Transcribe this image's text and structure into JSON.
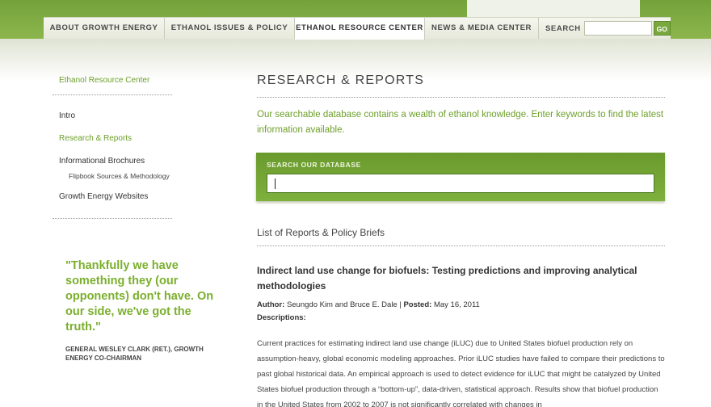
{
  "nav": {
    "tabs": [
      {
        "label": "ABOUT GROWTH ENERGY"
      },
      {
        "label": "ETHANOL ISSUES & POLICY"
      },
      {
        "label": "ETHANOL RESOURCE CENTER"
      },
      {
        "label": "NEWS & MEDIA CENTER"
      }
    ],
    "search_label": "SEARCH",
    "search_value": "",
    "go_label": "GO"
  },
  "sidebar": {
    "header": "Ethanol Resource Center",
    "items": [
      {
        "label": "Intro"
      },
      {
        "label": "Research & Reports"
      },
      {
        "label": "Informational Brochures"
      },
      {
        "label": "Flipbook Sources & Methodology"
      },
      {
        "label": "Growth Energy Websites"
      }
    ]
  },
  "quote": {
    "text": "\"Thankfully we have something they (our opponents) don't have. On our side, we've got the truth.\"",
    "attribution": "GENERAL WESLEY CLARK (RET.), GROWTH ENERGY CO-CHAIRMAN"
  },
  "main": {
    "title": "RESEARCH & REPORTS",
    "intro": "Our searchable database contains a wealth of ethanol knowledge. Enter keywords to find the latest information available.",
    "search_label": "SEARCH OUR DATABASE",
    "search_value": "",
    "list_heading": "List of Reports & Policy Briefs",
    "report": {
      "title": "Indirect land use change for biofuels: Testing predictions and improving analytical methodologies",
      "author_label": "Author:",
      "author": "Seungdo Kim and Bruce E. Dale",
      "posted_label": "Posted:",
      "posted": "May 16, 2011",
      "separator": " | ",
      "descriptions_label": "Descriptions:",
      "body": "Current practices for estimating indirect land use change (iLUC) due to United States biofuel production rely on assumption-heavy, global economic modeling approaches. Prior iLUC studies have failed to compare their predictions to past global historical data. An empirical approach is used to detect evidence for iLUC that might be catalyzed by United States biofuel production through a “bottom-up”, data-driven, statistical approach. Results show that biofuel production in the United States from 2002 to 2007 is not significantly correlated with changes in"
    }
  },
  "colors": {
    "brand_green": "#7aaf2c",
    "link_green": "#6d9f2a",
    "band_green": "#74a23a"
  }
}
